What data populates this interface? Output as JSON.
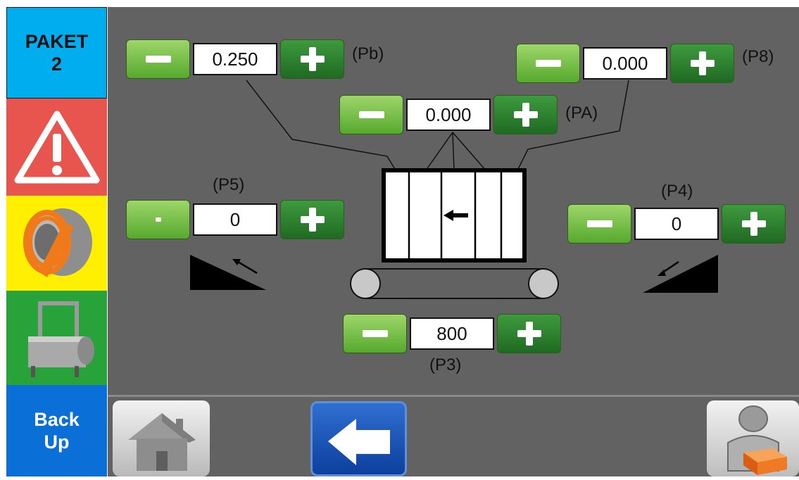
{
  "sidebar": {
    "package_label": "PAKET\n2",
    "backup_label": "Back\nUp",
    "icons": [
      "warning-icon",
      "strap-coil-icon",
      "strapping-machine-icon"
    ],
    "colors": {
      "package": "#00aeef",
      "warning": "#e8544e",
      "coil": "#ffef00",
      "machine": "#27a33a",
      "backup": "#0a6fd6"
    }
  },
  "params": {
    "pb": {
      "label": "(Pb)",
      "value": "0.250"
    },
    "p8": {
      "label": "(P8)",
      "value": "0.000"
    },
    "pa": {
      "label": "(PA)",
      "value": "0.000"
    },
    "p5": {
      "label": "(P5)",
      "value": "0"
    },
    "p4": {
      "label": "(P4)",
      "value": "0"
    },
    "p3": {
      "label": "(P3)",
      "value": "800"
    }
  },
  "bottom_bar": {
    "icons": [
      "home-icon",
      "back-arrow-icon",
      "operator-package-icon"
    ]
  }
}
